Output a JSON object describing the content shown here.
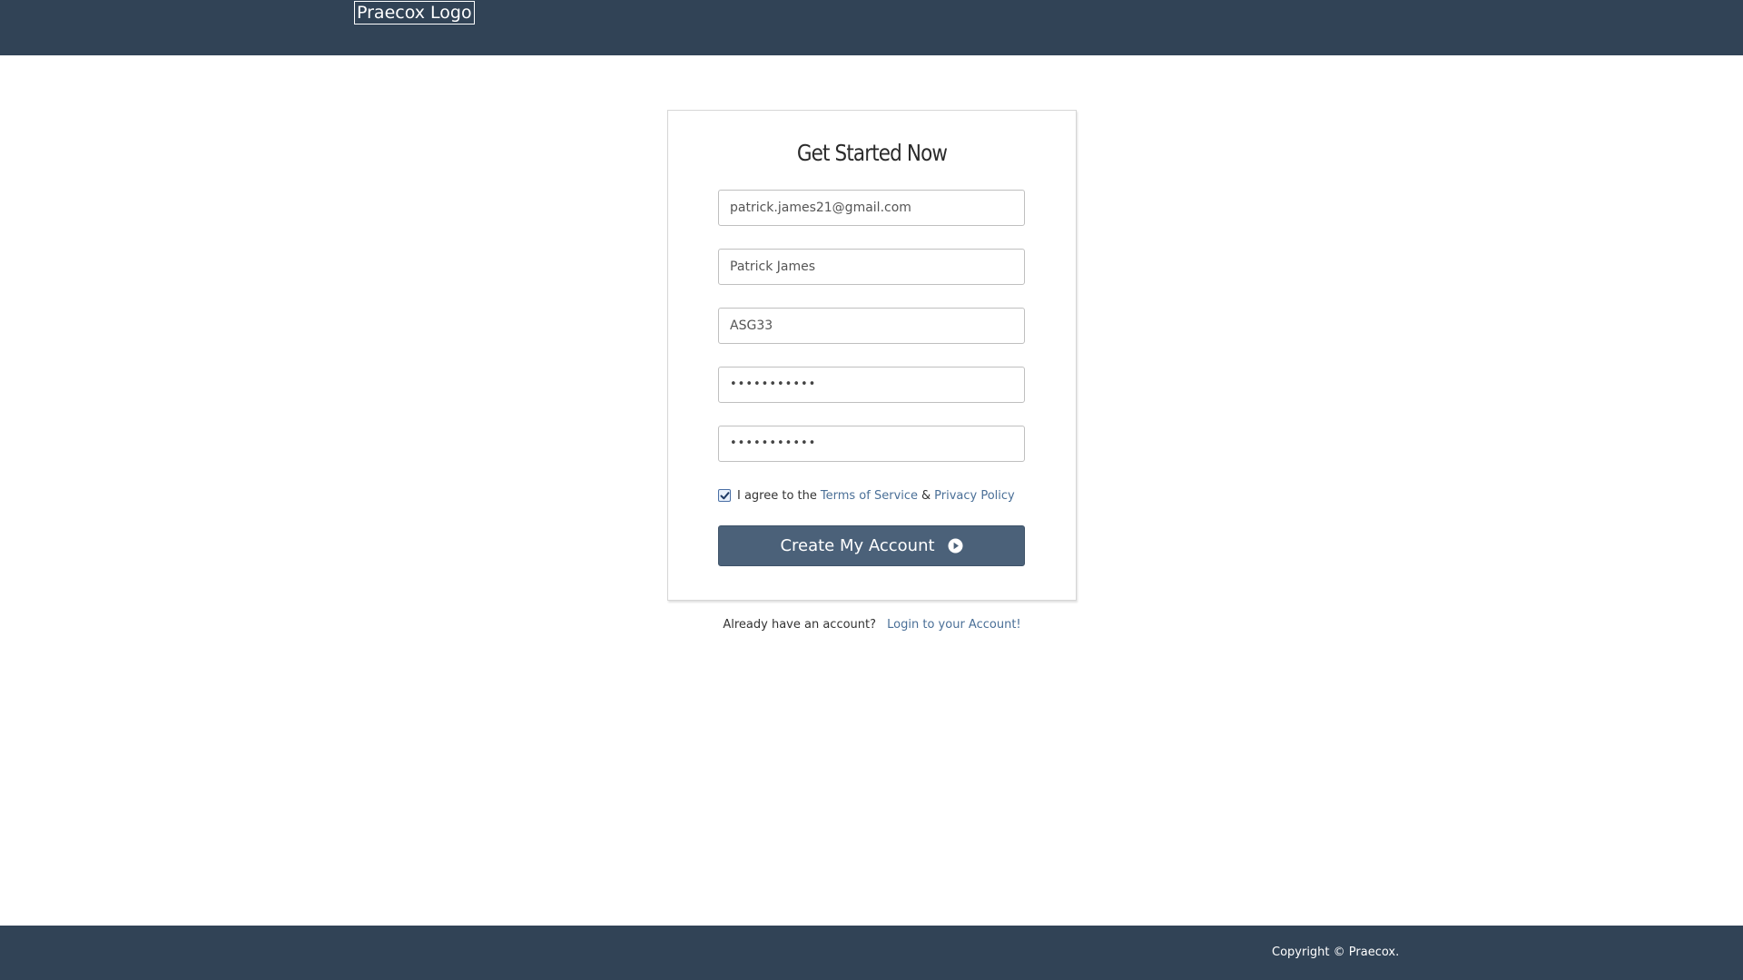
{
  "header": {
    "logo_text": "Praecox Logo"
  },
  "form": {
    "title": "Get Started Now",
    "email_value": "patrick.james21@gmail.com",
    "name_value": "Patrick James",
    "code_value": "ASG33",
    "password_value": "•••••••••••",
    "confirm_password_value": "•••••••••••",
    "agree_checked": true,
    "agree_prefix": "I agree to the",
    "terms_link": "Terms of Service",
    "ampersand": "&",
    "privacy_link": "Privacy Policy",
    "submit_label": "Create My Account",
    "submit_icon": "play-circle-icon"
  },
  "login": {
    "prompt": "Already have an account?",
    "link": "Login to your Account!"
  },
  "footer": {
    "copyright": "Copyright © Praecox."
  },
  "colors": {
    "header_bg": "#314356",
    "button_bg": "#4b6179",
    "link": "#4a6f97"
  }
}
